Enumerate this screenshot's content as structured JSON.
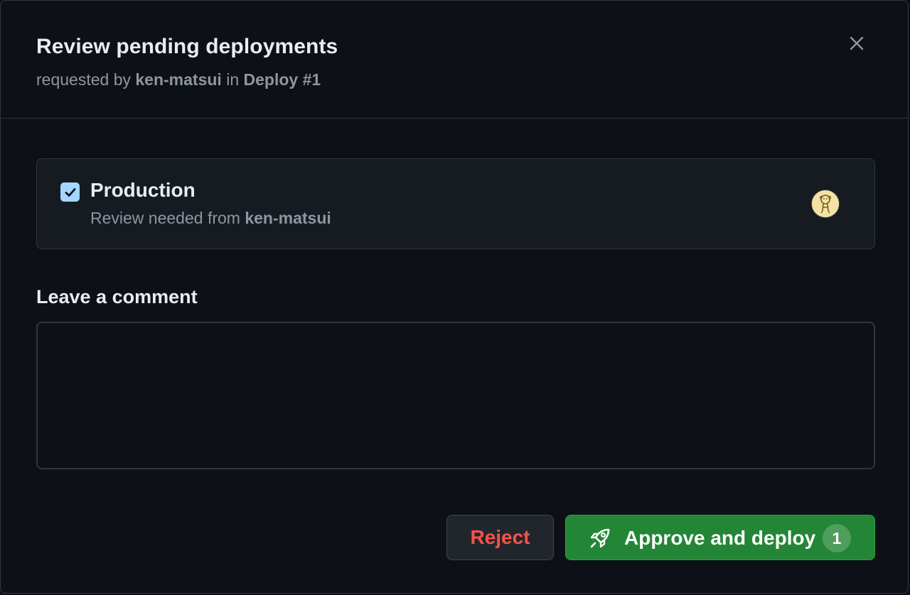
{
  "dialog": {
    "title": "Review pending deployments",
    "subtitle": {
      "prefix": "requested by",
      "user": "ken-matsui",
      "in": "in",
      "workflow": "Deploy #1"
    }
  },
  "environment": {
    "checked": true,
    "name": "Production",
    "review_prefix": "Review needed from",
    "reviewer": "ken-matsui"
  },
  "comment": {
    "label": "Leave a comment",
    "value": "",
    "placeholder": ""
  },
  "actions": {
    "reject_label": "Reject",
    "approve_label": "Approve and deploy",
    "approve_count": "1"
  },
  "colors": {
    "background": "#0d1117",
    "panel": "#161b22",
    "border": "#30363d",
    "text": "#e6edf3",
    "muted": "#8d96a0",
    "checkbox": "#a5d6ff",
    "reject": "#f85149",
    "approve": "#238636"
  },
  "icons": {
    "close": "x-icon",
    "check": "check-icon",
    "approve": "rocket-icon",
    "reviewer": "avatar"
  }
}
